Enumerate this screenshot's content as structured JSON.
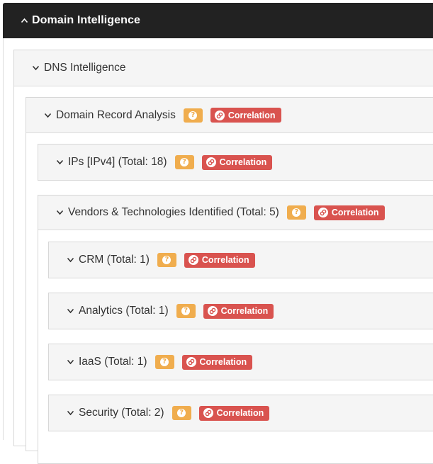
{
  "header": {
    "title": "Domain Intelligence",
    "icon": "chevron-up-icon"
  },
  "help_glyph": "?",
  "correlation_label": "Correlation",
  "colors": {
    "header_bg": "#222222",
    "help_badge": "#f0ad4e",
    "correlation_badge": "#d9534f",
    "panel_heading": "#f5f5f5"
  },
  "sections": {
    "dns": {
      "label": "DNS Intelligence",
      "icon": "chevron-down-icon"
    },
    "record": {
      "label": "Domain Record Analysis"
    },
    "ips": {
      "label": "IPs [IPv4] (Total: 18)"
    },
    "vendors": {
      "label": "Vendors & Technologies Identified (Total: 5)"
    },
    "crm": {
      "label": "CRM (Total: 1)"
    },
    "analytics": {
      "label": "Analytics (Total: 1)"
    },
    "iaas": {
      "label": "IaaS (Total: 1)"
    },
    "security": {
      "label": "Security (Total: 2)"
    }
  }
}
